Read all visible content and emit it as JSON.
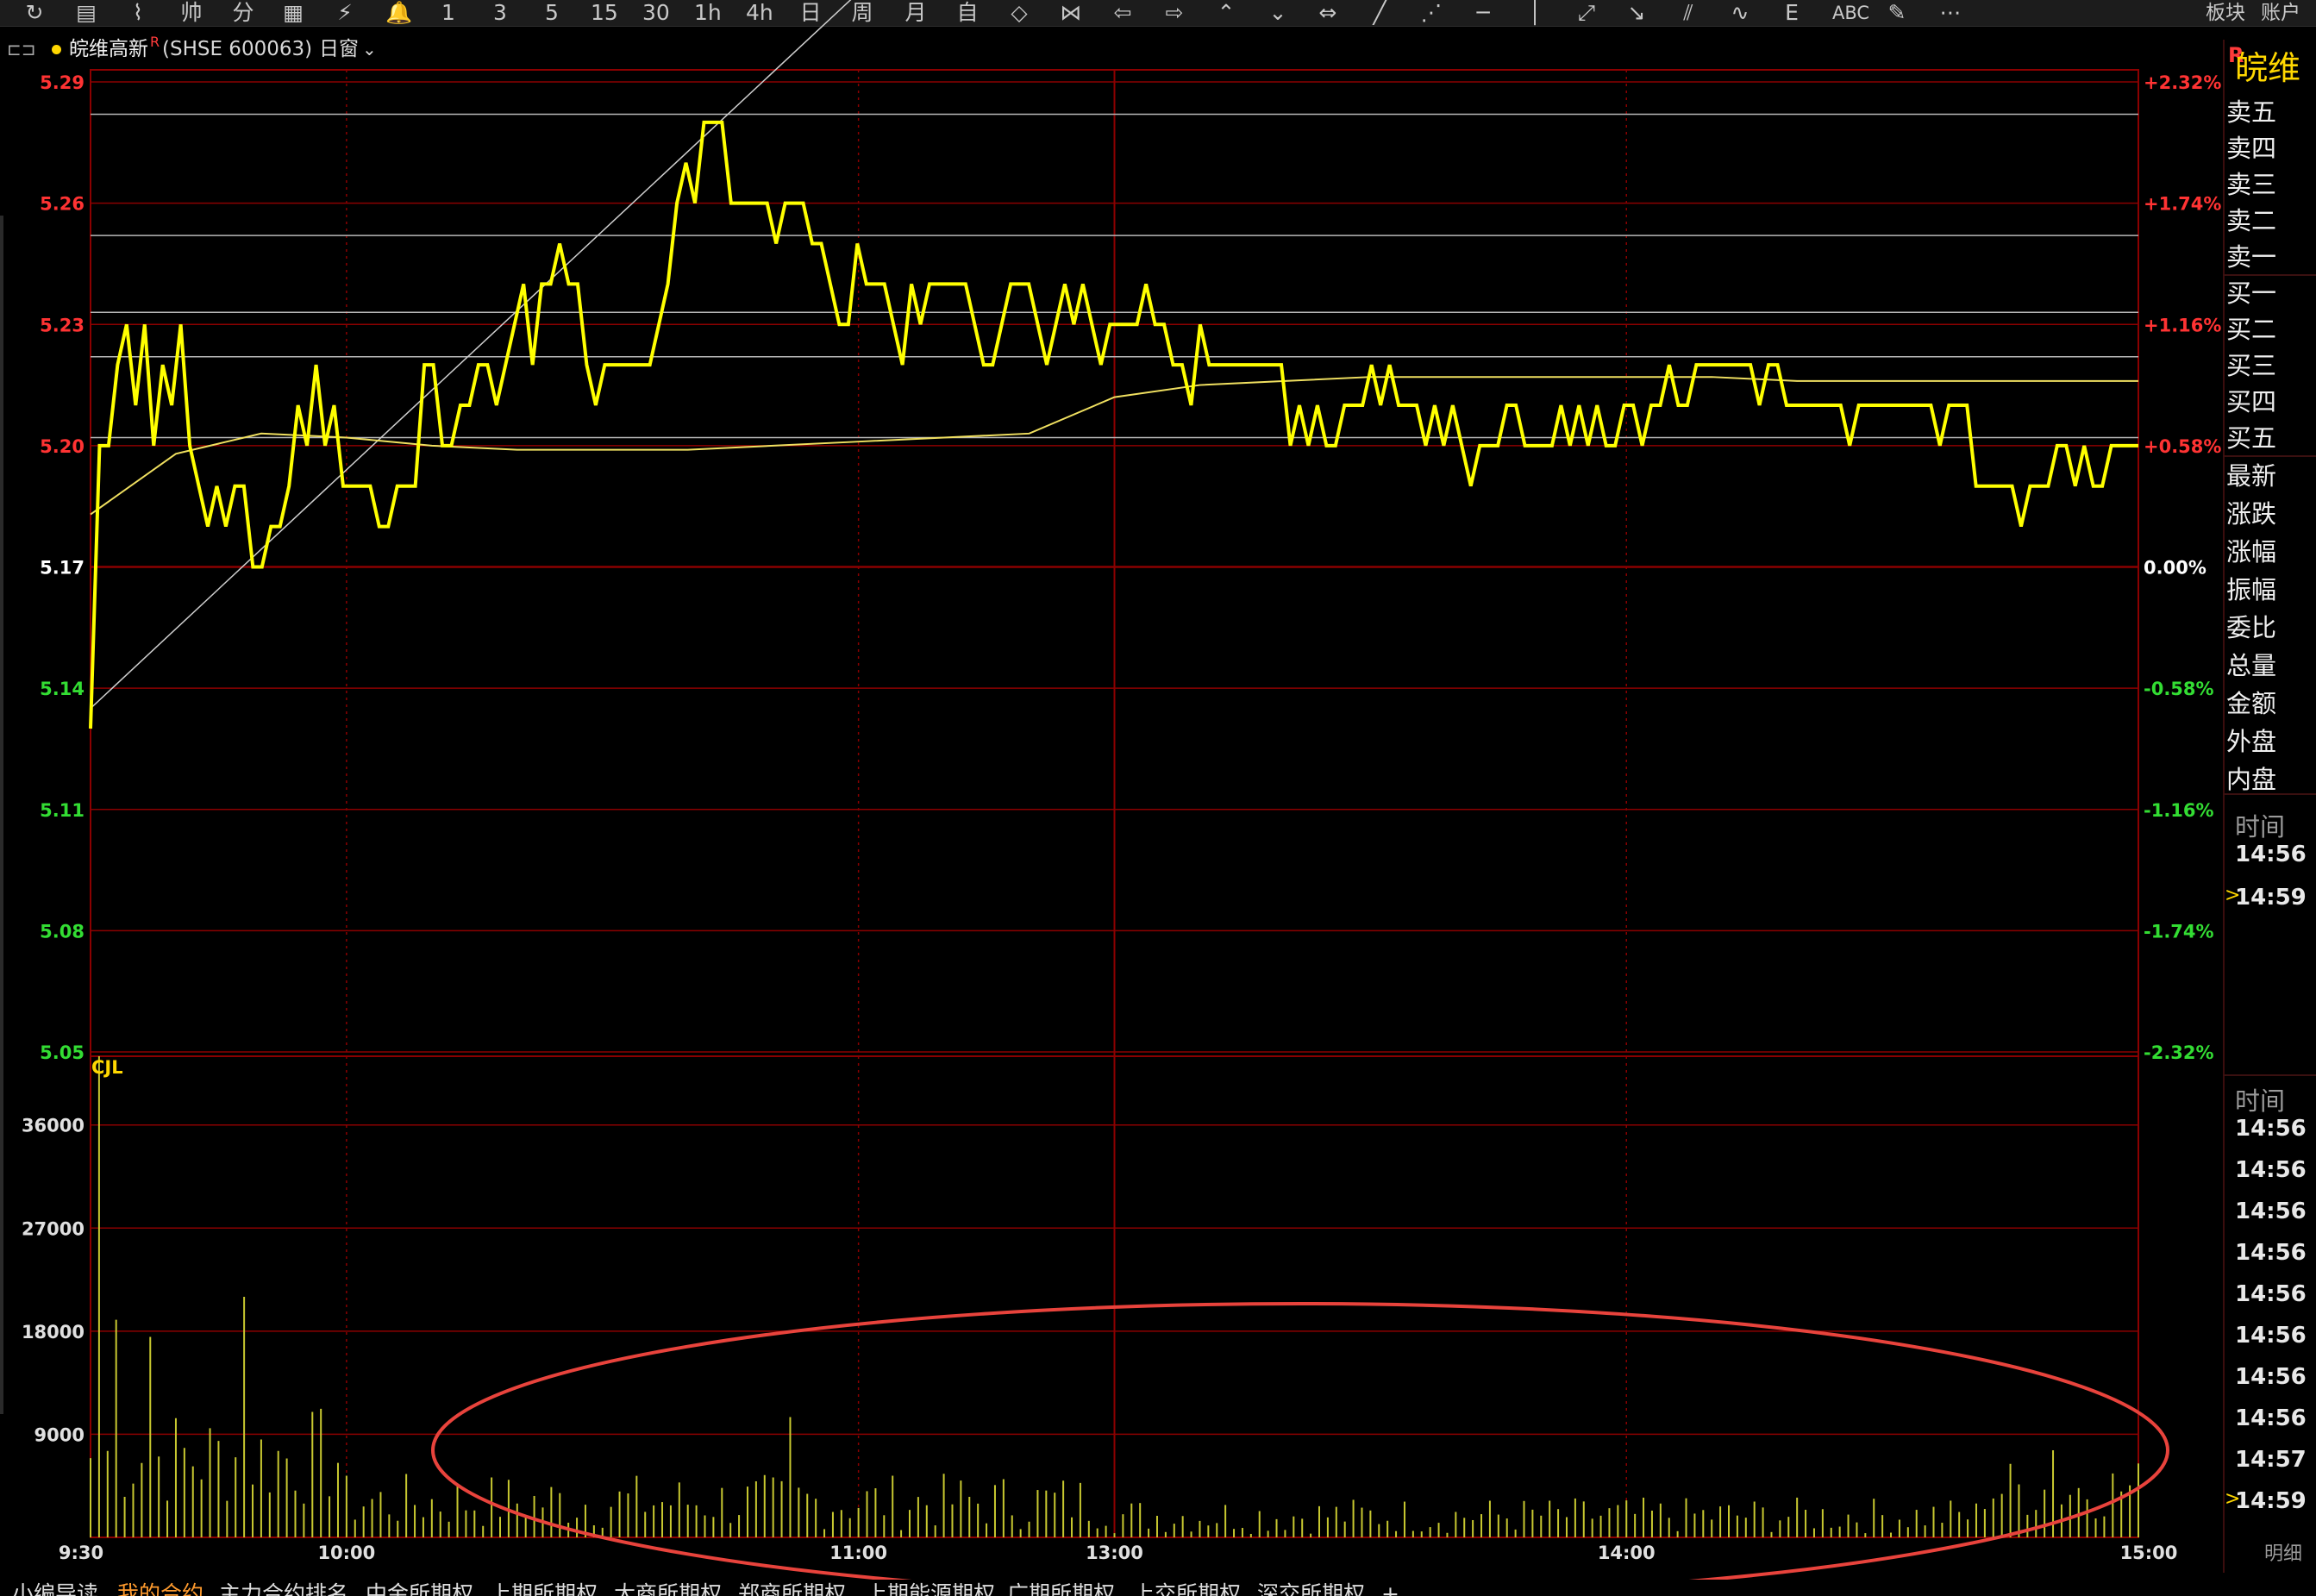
{
  "toolbar": {
    "tools": [
      {
        "label": "↻",
        "name": "refresh-icon"
      },
      {
        "label": "▤",
        "name": "list-view-icon"
      },
      {
        "label": "⌇",
        "name": "intraday-icon"
      },
      {
        "label": "帅",
        "name": "fenshi-icon"
      },
      {
        "label": "分",
        "name": "fenbi-icon"
      },
      {
        "label": "▦",
        "name": "kline-icon"
      },
      {
        "label": "⚡",
        "name": "flash-icon"
      },
      {
        "label": "🔔",
        "name": "bell-icon"
      },
      {
        "label": "1",
        "name": "period-1min"
      },
      {
        "label": "3",
        "name": "period-3min"
      },
      {
        "label": "5",
        "name": "period-5min"
      },
      {
        "label": "15",
        "name": "period-15min"
      },
      {
        "label": "30",
        "name": "period-30min"
      },
      {
        "label": "1h",
        "name": "period-1h"
      },
      {
        "label": "4h",
        "name": "period-4h"
      },
      {
        "label": "日",
        "name": "period-day"
      },
      {
        "label": "周",
        "name": "period-week"
      },
      {
        "label": "月",
        "name": "period-month"
      },
      {
        "label": "自",
        "name": "period-custom"
      },
      {
        "label": "◇",
        "name": "diamond-icon"
      },
      {
        "label": "⋈",
        "name": "bowtie-icon"
      },
      {
        "label": "⇦",
        "name": "arrow-left-icon"
      },
      {
        "label": "⇨",
        "name": "arrow-right-icon"
      },
      {
        "label": "⌃",
        "name": "chevron-up-icon"
      },
      {
        "label": "⌄",
        "name": "chevron-down-icon"
      },
      {
        "label": "⇔",
        "name": "fit-width-icon"
      },
      {
        "label": "╱",
        "name": "line-tool-icon"
      },
      {
        "label": "⋰",
        "name": "ray-tool-icon"
      },
      {
        "label": "─",
        "name": "hline-tool-icon"
      },
      {
        "label": "│",
        "name": "vline-tool-icon"
      },
      {
        "label": "⤢",
        "name": "segment-tool-icon"
      },
      {
        "label": "↘",
        "name": "arrow-tool-icon"
      },
      {
        "label": "⫽",
        "name": "channel-tool-icon"
      },
      {
        "label": "∿",
        "name": "wave-tool-icon"
      },
      {
        "label": "Ε",
        "name": "fib-tool-icon"
      },
      {
        "label": "ABC",
        "name": "text-tool-icon"
      },
      {
        "label": "✎",
        "name": "eraser-tool-icon"
      },
      {
        "label": "⋯",
        "name": "more-icon"
      }
    ],
    "right_items": [
      "板块",
      "账户"
    ]
  },
  "header": {
    "name": "皖维高新",
    "superscript": "R",
    "code": "(SHSE 600063)",
    "window_label": "日窗",
    "dropdown_icon": "chevron-down-icon"
  },
  "panel": {
    "stock_short": "皖维",
    "badge": "R",
    "quote_labels": [
      "卖五",
      "卖四",
      "卖三",
      "卖二",
      "卖一",
      "买一",
      "买二",
      "买三",
      "买四",
      "买五",
      "最新",
      "涨跌",
      "涨幅",
      "振幅",
      "委比",
      "总量",
      "金额",
      "外盘",
      "内盘"
    ],
    "ticks1_title": "时间",
    "ticks1": [
      "14:56",
      "14:59"
    ],
    "ticks2_title": "时间",
    "ticks2": [
      "14:56",
      "14:56",
      "14:56",
      "14:56",
      "14:56",
      "14:56",
      "14:56",
      "14:56",
      "14:57",
      "14:59"
    ],
    "detail_label": "明细"
  },
  "bottom_tabs": [
    "小编导读",
    "我的合约",
    "主力合约排名",
    "中金所期权",
    "上期所期权",
    "大商所期权",
    "郑商所期权",
    "上期能源期权",
    "广期所期权",
    "上交所期权",
    "深交所期权",
    "+"
  ],
  "bottom_active": 1,
  "colors": {
    "price_line": "#ffff00",
    "avg_line": "#f0e060",
    "grid_red": "#8b0000",
    "up": "#ff3333",
    "down": "#33dd33",
    "volume": "#c8c830",
    "annotation_circle": "#e8433c"
  },
  "chart_data": {
    "type": "line",
    "title": "",
    "prev_close": 5.17,
    "price_axis": {
      "ticks": [
        "5.29",
        "5.26",
        "5.23",
        "5.20",
        "5.17",
        "5.14",
        "5.11",
        "5.08",
        "5.05"
      ],
      "ylim": [
        5.05,
        5.29
      ]
    },
    "pct_axis": {
      "ticks": [
        "+2.32%",
        "+1.74%",
        "+1.16%",
        "+0.58%",
        "0.00%",
        "-0.58%",
        "-1.16%",
        "-1.74%",
        "-2.32%"
      ]
    },
    "time_axis": {
      "ticks": [
        "9:30",
        "10:00",
        "11:00",
        "13:00",
        "14:00",
        "15:00"
      ]
    },
    "drawn_levels": [
      5.282,
      5.252,
      5.233,
      5.222,
      5.202
    ],
    "trend_line": {
      "from": {
        "minute": 0,
        "price": 5.135
      },
      "to": {
        "minute": 94,
        "price": 5.32
      }
    },
    "series": [
      {
        "name": "price",
        "step_minutes": 1,
        "values": [
          5.13,
          5.2,
          5.2,
          5.22,
          5.23,
          5.21,
          5.23,
          5.2,
          5.22,
          5.21,
          5.23,
          5.2,
          5.19,
          5.18,
          5.19,
          5.18,
          5.19,
          5.19,
          5.17,
          5.17,
          5.18,
          5.18,
          5.19,
          5.21,
          5.2,
          5.22,
          5.2,
          5.21,
          5.19,
          5.19,
          5.19,
          5.19,
          5.18,
          5.18,
          5.19,
          5.19,
          5.19,
          5.22,
          5.22,
          5.2,
          5.2,
          5.21,
          5.21,
          5.22,
          5.22,
          5.21,
          5.22,
          5.23,
          5.24,
          5.22,
          5.24,
          5.24,
          5.25,
          5.24,
          5.24,
          5.22,
          5.21,
          5.22,
          5.22,
          5.22,
          5.22,
          5.22,
          5.22,
          5.23,
          5.24,
          5.26,
          5.27,
          5.26,
          5.28,
          5.28,
          5.28,
          5.26,
          5.26,
          5.26,
          5.26,
          5.26,
          5.25,
          5.26,
          5.26,
          5.26,
          5.25,
          5.25,
          5.24,
          5.23,
          5.23,
          5.25,
          5.24,
          5.24,
          5.24,
          5.23,
          5.22,
          5.24,
          5.23,
          5.24,
          5.24,
          5.24,
          5.24,
          5.24,
          5.23,
          5.22,
          5.22,
          5.23,
          5.24,
          5.24,
          5.24,
          5.23,
          5.22,
          5.23,
          5.24,
          5.23,
          5.24,
          5.23,
          5.22,
          5.23,
          5.23,
          5.23,
          5.23,
          5.24,
          5.23,
          5.23,
          5.22,
          5.22,
          5.21,
          5.23,
          5.22,
          5.22,
          5.22,
          5.22,
          5.22,
          5.22,
          5.22,
          5.22,
          5.22,
          5.2,
          5.21,
          5.2,
          5.21,
          5.2,
          5.2,
          5.21,
          5.21,
          5.21,
          5.22,
          5.21,
          5.22,
          5.21,
          5.21,
          5.21,
          5.2,
          5.21,
          5.2,
          5.21,
          5.2,
          5.19,
          5.2,
          5.2,
          5.2,
          5.21,
          5.21,
          5.2,
          5.2,
          5.2,
          5.2,
          5.21,
          5.2,
          5.21,
          5.2,
          5.21,
          5.2,
          5.2,
          5.21,
          5.21,
          5.2,
          5.21,
          5.21,
          5.22,
          5.21,
          5.21,
          5.22,
          5.22,
          5.22,
          5.22,
          5.22,
          5.22,
          5.22,
          5.21,
          5.22,
          5.22,
          5.21,
          5.21,
          5.21,
          5.21,
          5.21,
          5.21,
          5.21,
          5.2,
          5.21,
          5.21,
          5.21,
          5.21,
          5.21,
          5.21,
          5.21,
          5.21,
          5.21,
          5.2,
          5.21,
          5.21,
          5.21,
          5.19,
          5.19,
          5.19,
          5.19,
          5.19,
          5.18,
          5.19,
          5.19,
          5.19,
          5.2,
          5.2,
          5.19,
          5.2,
          5.19,
          5.19,
          5.2,
          5.2,
          5.2,
          5.2
        ]
      },
      {
        "name": "average",
        "step_minutes": 10,
        "values": [
          5.183,
          5.198,
          5.203,
          5.202,
          5.2,
          5.199,
          5.199,
          5.199,
          5.2,
          5.201,
          5.202,
          5.203,
          5.212,
          5.215,
          5.216,
          5.217,
          5.217,
          5.217,
          5.217,
          5.217,
          5.216,
          5.216,
          5.216,
          5.216,
          5.216
        ]
      }
    ],
    "volume": {
      "label": "CJL",
      "ticks": [
        "36000",
        "27000",
        "18000",
        "9000"
      ],
      "ylim": [
        0,
        42000
      ],
      "peaks": [
        {
          "minute": 1,
          "value": 42000
        },
        {
          "minute": 3,
          "value": 19000
        },
        {
          "minute": 7,
          "value": 17500
        },
        {
          "minute": 18,
          "value": 21000
        },
        {
          "minute": 82,
          "value": 10500
        },
        {
          "minute": 230,
          "value": 7600
        }
      ]
    }
  }
}
